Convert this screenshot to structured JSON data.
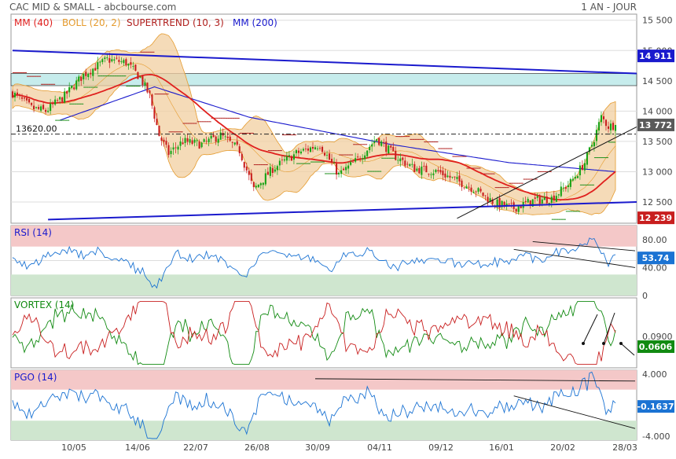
{
  "header": {
    "title": "CAC MID & SMALL - abcbourse.com",
    "period": "1 AN - JOUR"
  },
  "colors": {
    "background": "#ffffff",
    "panel_border": "#9a9a9a",
    "grid": "#dddddd",
    "candle_up": "#16a316",
    "candle_down": "#c81e1e",
    "mm40": "#e0201e",
    "boll_fill": "#f1cfa0",
    "boll_line": "#e59b2e",
    "supertrend": "#b0201e",
    "supertrend_up": "#1c8f1c",
    "mm200": "#1a1acd",
    "trendline": "#1a1acd",
    "resistance_zone": "#c6ecec",
    "price_tag": "#2a2a2a",
    "current_tag": "#5a5a5a",
    "rsi_tag": "#1b73d3",
    "low_tag": "#c81e1e",
    "vortex_tag": "#118a11",
    "pgo_tag": "#1b73d3",
    "zone_high": "#f4c8c8",
    "zone_low": "#cfe6cf",
    "rsi_line": "#1b73d3",
    "vortex_plus": "#118a11",
    "vortex_minus": "#c81e1e"
  },
  "legend": [
    {
      "label": "MM (40)",
      "color": "#e0201e"
    },
    {
      "label": "BOLL (20, 2)",
      "color": "#e59b2e"
    },
    {
      "label": "SUPERTREND (10, 3)",
      "color": "#b0201e"
    },
    {
      "label": "MM (200)",
      "color": "#1a1acd"
    }
  ],
  "chart_data": [
    {
      "type": "candlestick",
      "panel": "price",
      "ylim": [
        12150,
        15600
      ],
      "yticks": [
        12500,
        13000,
        13500,
        14000,
        14500,
        15000,
        15500
      ],
      "ytick_labels": [
        "12 500",
        "13 000",
        "13 500",
        "14 000",
        "14 500",
        "15 000",
        "15 500"
      ],
      "x_tick_labels": [
        "10/05",
        "14/06",
        "22/07",
        "26/08",
        "30/09",
        "04/11",
        "09/12",
        "16/01",
        "20/02",
        "28/03"
      ],
      "reference_level": {
        "value": 13620,
        "label": "13620.00"
      },
      "last_price": {
        "value": 13772,
        "label": "13 772"
      },
      "tag_14911": {
        "value": 14911,
        "label": "14 911"
      },
      "tag_12239": {
        "value": 12239,
        "label": "12 239"
      },
      "resistance_zone": [
        14420,
        14620
      ],
      "trendlines": [
        {
          "from": [
            0,
            15000
          ],
          "to": [
            255,
            14620
          ]
        },
        {
          "from": [
            15,
            12210
          ],
          "to": [
            255,
            12500
          ]
        },
        {
          "from": [
            188,
            12230
          ],
          "to": [
            255,
            13740
          ]
        }
      ],
      "series_legend": [
        "MM (40)",
        "BOLL (20, 2)",
        "SUPERTREND (10, 3)",
        "MM (200)"
      ]
    },
    {
      "type": "line",
      "panel": "rsi",
      "title": "RSI (14)",
      "ylim": [
        0,
        100
      ],
      "yticks": [
        0,
        40,
        80
      ],
      "ytick_labels": [
        "0",
        "40.00",
        "80.00"
      ],
      "zones": {
        "upper": [
          70,
          100
        ],
        "lower": [
          0,
          30
        ]
      },
      "last_value": {
        "value": 53.74,
        "label": "53.74"
      }
    },
    {
      "type": "line",
      "panel": "vortex",
      "title": "VORTEX (14)",
      "ylim": [
        0,
        0.2
      ],
      "yticks": [
        0.09
      ],
      "ytick_labels": [
        "0.0900"
      ],
      "last_value": {
        "value": 0.0606,
        "label": "0.0606"
      }
    },
    {
      "type": "line",
      "panel": "pgo",
      "title": "PGO (14)",
      "ylim": [
        -4.5,
        4.5
      ],
      "yticks": [
        4,
        -4
      ],
      "ytick_labels": [
        "4.000",
        "-4.000"
      ],
      "zones": {
        "upper": [
          2,
          4.5
        ],
        "lower": [
          -4.5,
          -2
        ]
      },
      "last_value": {
        "value": -0.1637,
        "label": "-0.1637"
      }
    }
  ]
}
